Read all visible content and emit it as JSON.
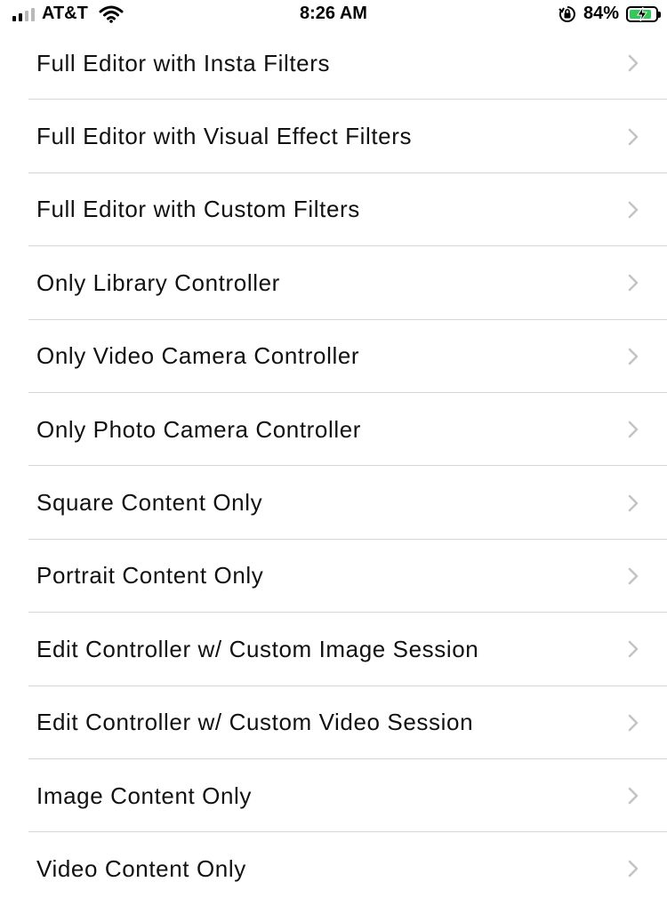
{
  "status_bar": {
    "carrier": "AT&T",
    "time": "8:26 AM",
    "battery_percent": "84%",
    "battery_level": 0.84,
    "icons": [
      "cellular-signal-icon",
      "wifi-icon",
      "orientation-lock-icon",
      "battery-charging-icon"
    ]
  },
  "menu": {
    "items": [
      {
        "label": "Full Editor with Insta Filters"
      },
      {
        "label": "Full Editor with Visual Effect Filters"
      },
      {
        "label": "Full Editor with Custom Filters"
      },
      {
        "label": "Only Library Controller"
      },
      {
        "label": "Only Video Camera Controller"
      },
      {
        "label": "Only Photo Camera Controller"
      },
      {
        "label": "Square Content Only"
      },
      {
        "label": "Portrait Content Only"
      },
      {
        "label": "Edit Controller w/ Custom Image Session"
      },
      {
        "label": "Edit Controller w/ Custom Video Session"
      },
      {
        "label": "Image Content Only"
      },
      {
        "label": "Video Content Only"
      }
    ]
  },
  "colors": {
    "separator": "#d6d6d9",
    "chevron": "#c4c4c7",
    "battery_fill": "#34c759"
  }
}
